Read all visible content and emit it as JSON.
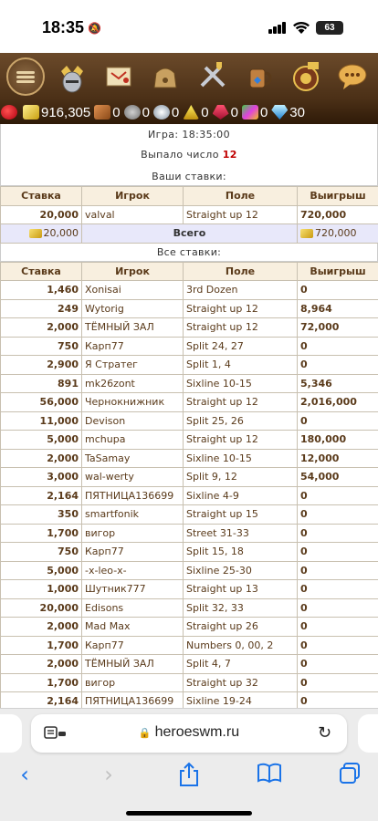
{
  "status_bar": {
    "time": "18:35",
    "battery": "63"
  },
  "nav_icons": [
    "menu-icon",
    "knight-helmet-icon",
    "map-scroll-icon",
    "bag-icon",
    "battle-swords-icon",
    "tavern-icon",
    "roulette-icon",
    "chat-icon"
  ],
  "resources": [
    {
      "icon": "heart-icon",
      "value": "",
      "color": "#d81b20"
    },
    {
      "icon": "gold-icon",
      "value": "916,305",
      "color": "#e8c030"
    },
    {
      "icon": "wood-icon",
      "value": "0",
      "color": "#b56a2a"
    },
    {
      "icon": "ore-icon",
      "value": "0",
      "color": "#9a9a9a"
    },
    {
      "icon": "mercury-icon",
      "value": "0",
      "color": "#c0c8d0"
    },
    {
      "icon": "sulfur-icon",
      "value": "0",
      "color": "#e0c020"
    },
    {
      "icon": "crystal-icon",
      "value": "0",
      "color": "#d02040"
    },
    {
      "icon": "gems-icon",
      "value": "0",
      "color": "#c040c0"
    },
    {
      "icon": "diamond-icon",
      "value": "30",
      "color": "#40a0e0"
    }
  ],
  "game": {
    "label": "Игра: 18:35:00",
    "result_prefix": "Выпало число",
    "result_number": "12"
  },
  "your_bets": {
    "title": "Ваши ставки:",
    "headers": [
      "Ставка",
      "Игрок",
      "Поле",
      "Выигрыш"
    ],
    "rows": [
      {
        "bet": "20,000",
        "player": "valval",
        "field": "Straight up 12",
        "win": "720,000"
      }
    ],
    "total": {
      "bet": "20,000",
      "label": "Всего",
      "win": "720,000"
    }
  },
  "all_bets": {
    "title": "Все ставки:",
    "headers": [
      "Ставка",
      "Игрок",
      "Поле",
      "Выигрыш"
    ],
    "rows": [
      {
        "bet": "1,460",
        "player": "Xonisai",
        "field": "3rd Dozen",
        "win": "0"
      },
      {
        "bet": "249",
        "player": "Wytorig",
        "field": "Straight up 12",
        "win": "8,964"
      },
      {
        "bet": "2,000",
        "player": "ТЁМНЫЙ ЗАЛ",
        "field": "Straight up 12",
        "win": "72,000"
      },
      {
        "bet": "750",
        "player": "Карп77",
        "field": "Split 24, 27",
        "win": "0"
      },
      {
        "bet": "2,900",
        "player": "Я Стратег",
        "field": "Split 1, 4",
        "win": "0"
      },
      {
        "bet": "891",
        "player": "mk26zont",
        "field": "Sixline 10-15",
        "win": "5,346"
      },
      {
        "bet": "56,000",
        "player": "Чернокнижник",
        "field": "Straight up 12",
        "win": "2,016,000"
      },
      {
        "bet": "11,000",
        "player": "Devison",
        "field": "Split 25, 26",
        "win": "0"
      },
      {
        "bet": "5,000",
        "player": "mchupa",
        "field": "Straight up 12",
        "win": "180,000"
      },
      {
        "bet": "2,000",
        "player": "TaSamay",
        "field": "Sixline 10-15",
        "win": "12,000"
      },
      {
        "bet": "3,000",
        "player": "wal-werty",
        "field": "Split 9, 12",
        "win": "54,000"
      },
      {
        "bet": "2,164",
        "player": "ПЯТНИЦА136699",
        "field": "Sixline 4-9",
        "win": "0"
      },
      {
        "bet": "350",
        "player": "smartfonik",
        "field": "Straight up 15",
        "win": "0"
      },
      {
        "bet": "1,700",
        "player": "вигор",
        "field": "Street 31-33",
        "win": "0"
      },
      {
        "bet": "750",
        "player": "Карп77",
        "field": "Split 15, 18",
        "win": "0"
      },
      {
        "bet": "5,000",
        "player": "-x-leo-x-",
        "field": "Sixline 25-30",
        "win": "0"
      },
      {
        "bet": "1,000",
        "player": "Шутник777",
        "field": "Straight up 13",
        "win": "0"
      },
      {
        "bet": "20,000",
        "player": "Edisons",
        "field": "Split 32, 33",
        "win": "0"
      },
      {
        "bet": "2,000",
        "player": "Mad Max",
        "field": "Straight up 26",
        "win": "0"
      },
      {
        "bet": "1,700",
        "player": "Карп77",
        "field": "Numbers 0, 00, 2",
        "win": "0"
      },
      {
        "bet": "2,000",
        "player": "ТЁМНЫЙ ЗАЛ",
        "field": "Split 4, 7",
        "win": "0"
      },
      {
        "bet": "1,700",
        "player": "вигор",
        "field": "Straight up 32",
        "win": "0"
      },
      {
        "bet": "2,164",
        "player": "ПЯТНИЦА136699",
        "field": "Sixline 19-24",
        "win": "0"
      }
    ]
  },
  "browser": {
    "url": "heroeswm.ru"
  }
}
